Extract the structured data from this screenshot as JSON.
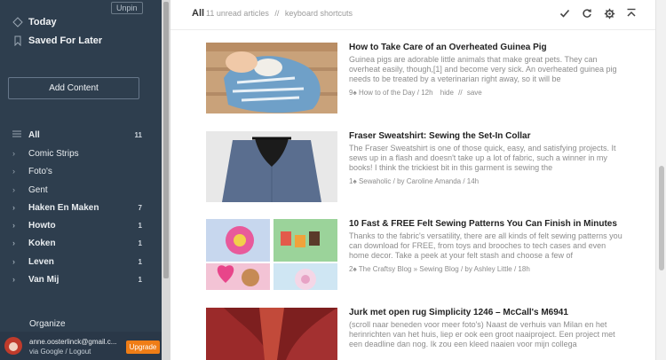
{
  "sidebar": {
    "unpin": "Unpin",
    "today": "Today",
    "saved": "Saved For Later",
    "add_content": "Add Content",
    "feeds": [
      {
        "label": "All",
        "count": "11",
        "bold": true
      },
      {
        "label": "Comic Strips",
        "count": ""
      },
      {
        "label": "Foto's",
        "count": ""
      },
      {
        "label": "Gent",
        "count": ""
      },
      {
        "label": "Haken En Maken",
        "count": "7",
        "bold": true
      },
      {
        "label": "Howto",
        "count": "1",
        "bold": true
      },
      {
        "label": "Koken",
        "count": "1",
        "bold": true
      },
      {
        "label": "Leven",
        "count": "1",
        "bold": true
      },
      {
        "label": "Van Mij",
        "count": "1",
        "bold": true
      }
    ],
    "organize": "Organize",
    "account": {
      "email": "anne.oosterlinck@gmail.c...",
      "via": "via Google / Logout",
      "upgrade": "Upgrade"
    }
  },
  "header": {
    "title": "All",
    "unread": "11 unread articles",
    "sep": "//",
    "shortcuts": "keyboard shortcuts",
    "actions": [
      "check-icon",
      "refresh-icon",
      "gear-icon",
      "collapse-icon"
    ]
  },
  "articles": [
    {
      "title": "How to Take Care of an Overheated Guinea Pig",
      "excerpt": "Guinea pigs are adorable little animals that make great pets. They can overheat easily, though,[1] and become very sick. An overheated guinea pig needs to be treated by a veterinarian right away, so it will be",
      "count": "9",
      "source": "How to of the Day / 12h",
      "hide": "hide",
      "save": "save"
    },
    {
      "title": "Fraser Sweatshirt: Sewing the Set-In Collar",
      "excerpt": "The Fraser Sweatshirt is one of those quick, easy, and satisfying projects. It sews up in a flash and doesn't take up a lot of fabric, such a winner in my books! I think the trickiest bit in this garment is sewing the",
      "count": "1",
      "source": "Sewaholic / by Caroline Amanda / 14h"
    },
    {
      "title": "10 Fast & FREE Felt Sewing Patterns You Can Finish in Minutes",
      "excerpt": "Thanks to the fabric's versatility, there are all kinds of felt sewing patterns you can download for FREE, from toys and brooches to tech cases and even home decor. Take a peek at your felt stash and choose a few of",
      "count": "2",
      "source": "The Craftsy Blog » Sewing Blog / by Ashley Little / 18h"
    },
    {
      "title": "Jurk met open rug Simplicity 1246 – McCall's M6941",
      "excerpt": "(scroll naar beneden voor meer foto's) Naast de verhuis van Milan en het herinrichten van het huis, liep er ook een groot naaiproject. Een project met een deadline dan nog. Ik zou een kleed naaien voor mijn collega",
      "count": "",
      "source": ""
    }
  ]
}
